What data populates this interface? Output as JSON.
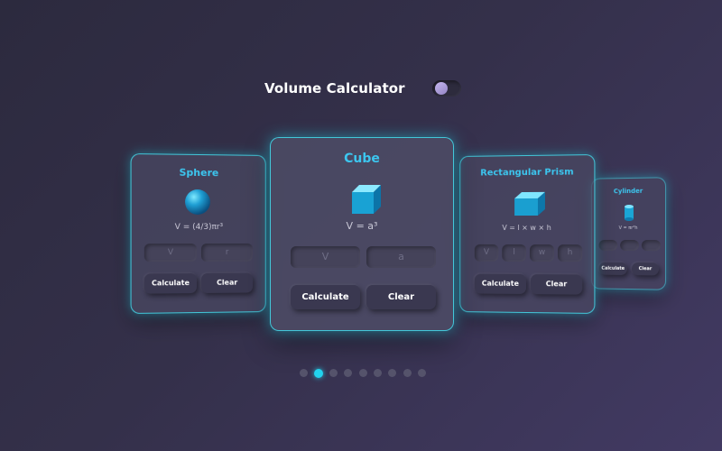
{
  "app": {
    "title": "Volume Calculator",
    "theme_toggle": {
      "on": false
    }
  },
  "cards": {
    "sphere": {
      "title": "Sphere",
      "formula": "V = (4/3)πr³",
      "icon": "sphere-icon",
      "inputs": [
        {
          "placeholder": "V"
        },
        {
          "placeholder": "r"
        }
      ],
      "calculate_label": "Calculate",
      "clear_label": "Clear"
    },
    "cube": {
      "title": "Cube",
      "formula": "V = a³",
      "icon": "cube-icon",
      "inputs": [
        {
          "placeholder": "V"
        },
        {
          "placeholder": "a"
        }
      ],
      "calculate_label": "Calculate",
      "clear_label": "Clear"
    },
    "prism": {
      "title": "Rectangular Prism",
      "formula": "V = l × w × h",
      "icon": "prism-icon",
      "inputs": [
        {
          "placeholder": "V"
        },
        {
          "placeholder": "l"
        },
        {
          "placeholder": "w"
        },
        {
          "placeholder": "h"
        }
      ],
      "calculate_label": "Calculate",
      "clear_label": "Clear"
    },
    "cylinder": {
      "title": "Cylinder",
      "formula": "V = πr²h",
      "icon": "cylinder-icon",
      "inputs": [
        {
          "placeholder": ""
        },
        {
          "placeholder": ""
        },
        {
          "placeholder": ""
        }
      ],
      "calculate_label": "Calculate",
      "clear_label": "Clear"
    }
  },
  "pagination": {
    "count": 9,
    "active_index": 1
  },
  "colors": {
    "accent": "#22d3ee",
    "card_title": "#3cc6ef",
    "background": "#34304a"
  }
}
